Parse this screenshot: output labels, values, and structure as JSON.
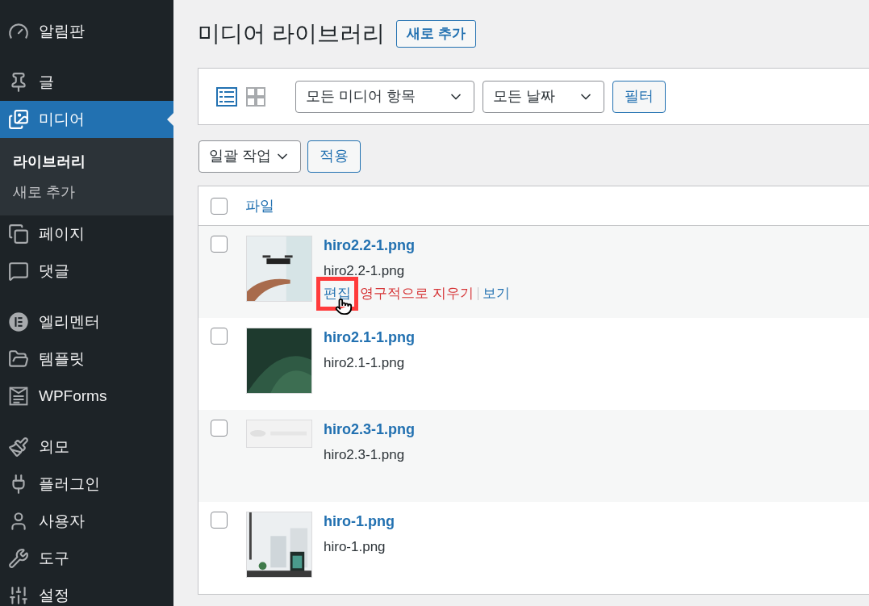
{
  "sidebar": {
    "groups": [
      {
        "items": [
          {
            "label": "알림판",
            "selected": false
          }
        ]
      },
      {
        "items": [
          {
            "label": "글",
            "selected": false
          },
          {
            "label": "미디어",
            "selected": true,
            "children": [
              {
                "label": "라이브러리",
                "selected": true
              },
              {
                "label": "새로 추가",
                "selected": false
              }
            ]
          },
          {
            "label": "페이지",
            "selected": false
          },
          {
            "label": "댓글",
            "selected": false
          }
        ]
      },
      {
        "items": [
          {
            "label": "엘리멘터",
            "selected": false
          },
          {
            "label": "템플릿",
            "selected": false
          },
          {
            "label": "WPForms",
            "selected": false
          }
        ]
      },
      {
        "items": [
          {
            "label": "외모",
            "selected": false
          },
          {
            "label": "플러그인",
            "selected": false
          },
          {
            "label": "사용자",
            "selected": false
          },
          {
            "label": "도구",
            "selected": false
          },
          {
            "label": "설정",
            "selected": false
          }
        ]
      }
    ]
  },
  "page": {
    "title": "미디어 라이브러리",
    "add_button": "새로 추가"
  },
  "toolbar": {
    "views": [
      {
        "kind": "list",
        "selected": true
      },
      {
        "kind": "grid",
        "selected": false
      }
    ],
    "type_filter": "모든 미디어 항목",
    "date_filter": "모든 날짜",
    "filter_button": "필터"
  },
  "bulk": {
    "action": "일괄 작업",
    "apply": "적용"
  },
  "table": {
    "select_all": {
      "checked": false
    },
    "columns": [
      {
        "label": "파일"
      }
    ],
    "rows": [
      {
        "title": "hiro2.2-1.png",
        "filename": "hiro2.2-1.png",
        "checked": false,
        "actions": [
          {
            "kind": "edit",
            "label": "편집",
            "highlighted": true
          },
          {
            "kind": "delete",
            "label": "영구적으로 지우기",
            "highlighted": false
          },
          {
            "kind": "view",
            "label": "보기",
            "highlighted": false
          }
        ]
      },
      {
        "title": "hiro2.1-1.png",
        "filename": "hiro2.1-1.png",
        "checked": false
      },
      {
        "title": "hiro2.3-1.png",
        "filename": "hiro2.3-1.png",
        "checked": false
      },
      {
        "title": "hiro-1.png",
        "filename": "hiro-1.png",
        "checked": false
      }
    ]
  }
}
